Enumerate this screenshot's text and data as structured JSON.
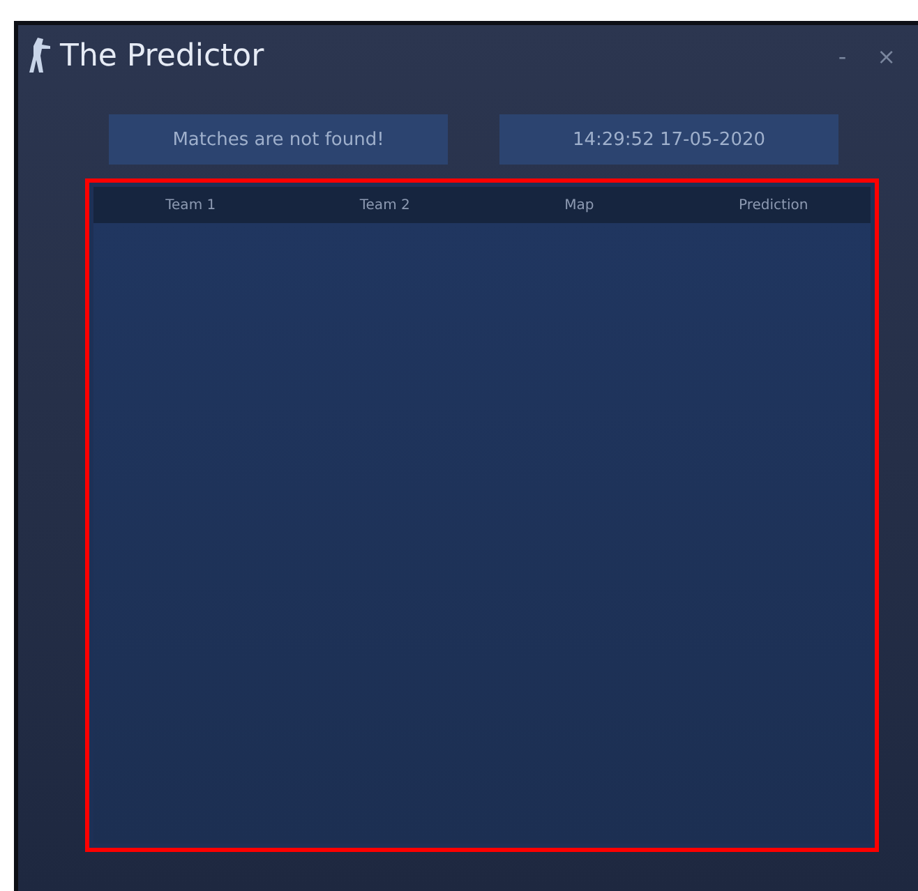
{
  "window": {
    "title": "The Predictor",
    "controls": [
      "-",
      "×"
    ]
  },
  "status": {
    "message": "Matches are not found!",
    "datetime": "14:29:52 17-05-2020"
  },
  "table": {
    "highlighted": true,
    "columns": [
      "Team 1",
      "Team 2",
      "Map",
      "Prediction"
    ]
  }
}
